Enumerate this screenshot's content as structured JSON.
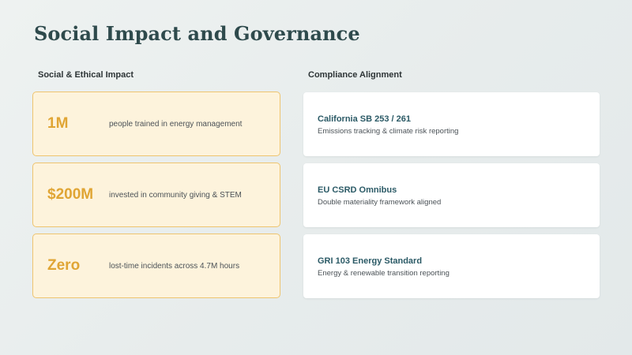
{
  "title": "Social Impact and Governance",
  "social": {
    "heading": "Social & Ethical Impact",
    "metrics": [
      {
        "value": "1M",
        "description": "people trained in energy management"
      },
      {
        "value": "$200M",
        "description": "invested in community giving & STEM"
      },
      {
        "value": "Zero",
        "description": "lost-time incidents across 4.7M hours"
      }
    ]
  },
  "compliance": {
    "heading": "Compliance Alignment",
    "items": [
      {
        "title": "California SB 253 / 261",
        "description": "Emissions tracking & climate risk reporting"
      },
      {
        "title": "EU CSRD Omnibus",
        "description": "Double materiality framework aligned"
      },
      {
        "title": "GRI 103 Energy Standard",
        "description": "Energy & renewable transition reporting"
      }
    ]
  },
  "colors": {
    "title": "#2e4a4c",
    "metric_accent": "#e0a534",
    "metric_card_fill": "#fdf3dc",
    "metric_card_border": "#eec46f",
    "compliance_title": "#2b5a66",
    "compliance_card_fill": "#ffffff"
  }
}
